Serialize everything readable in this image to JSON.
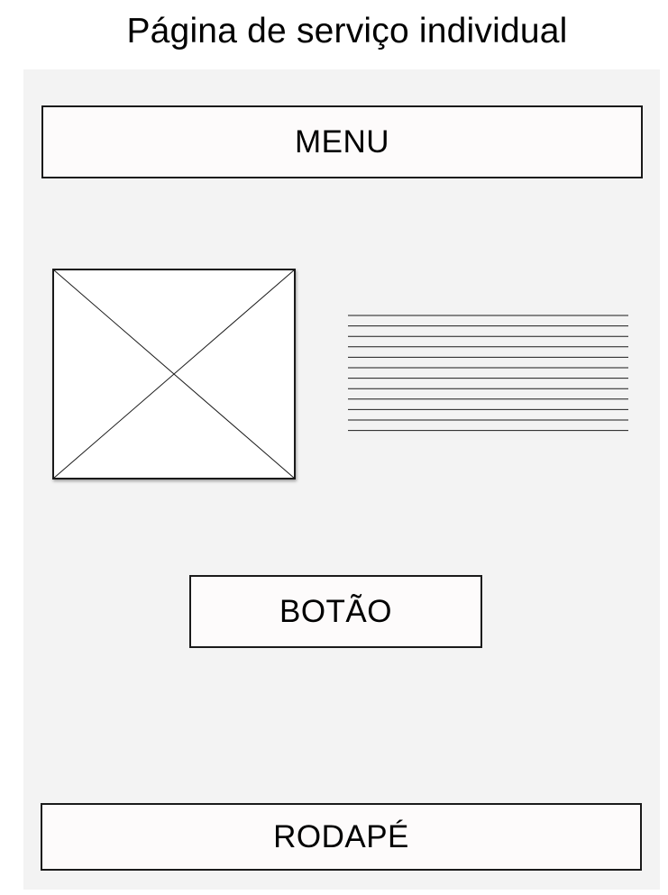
{
  "page": {
    "title": "Página de serviço individual"
  },
  "wireframe": {
    "menu_label": "MENU",
    "button_label": "BOTÃO",
    "footer_label": "RODAPÉ",
    "text_block_line_count": 12,
    "colors": {
      "canvas_background": "#f3f3f3",
      "box_fill": "#fdfbfb",
      "stroke": "#1a1a1a"
    }
  }
}
